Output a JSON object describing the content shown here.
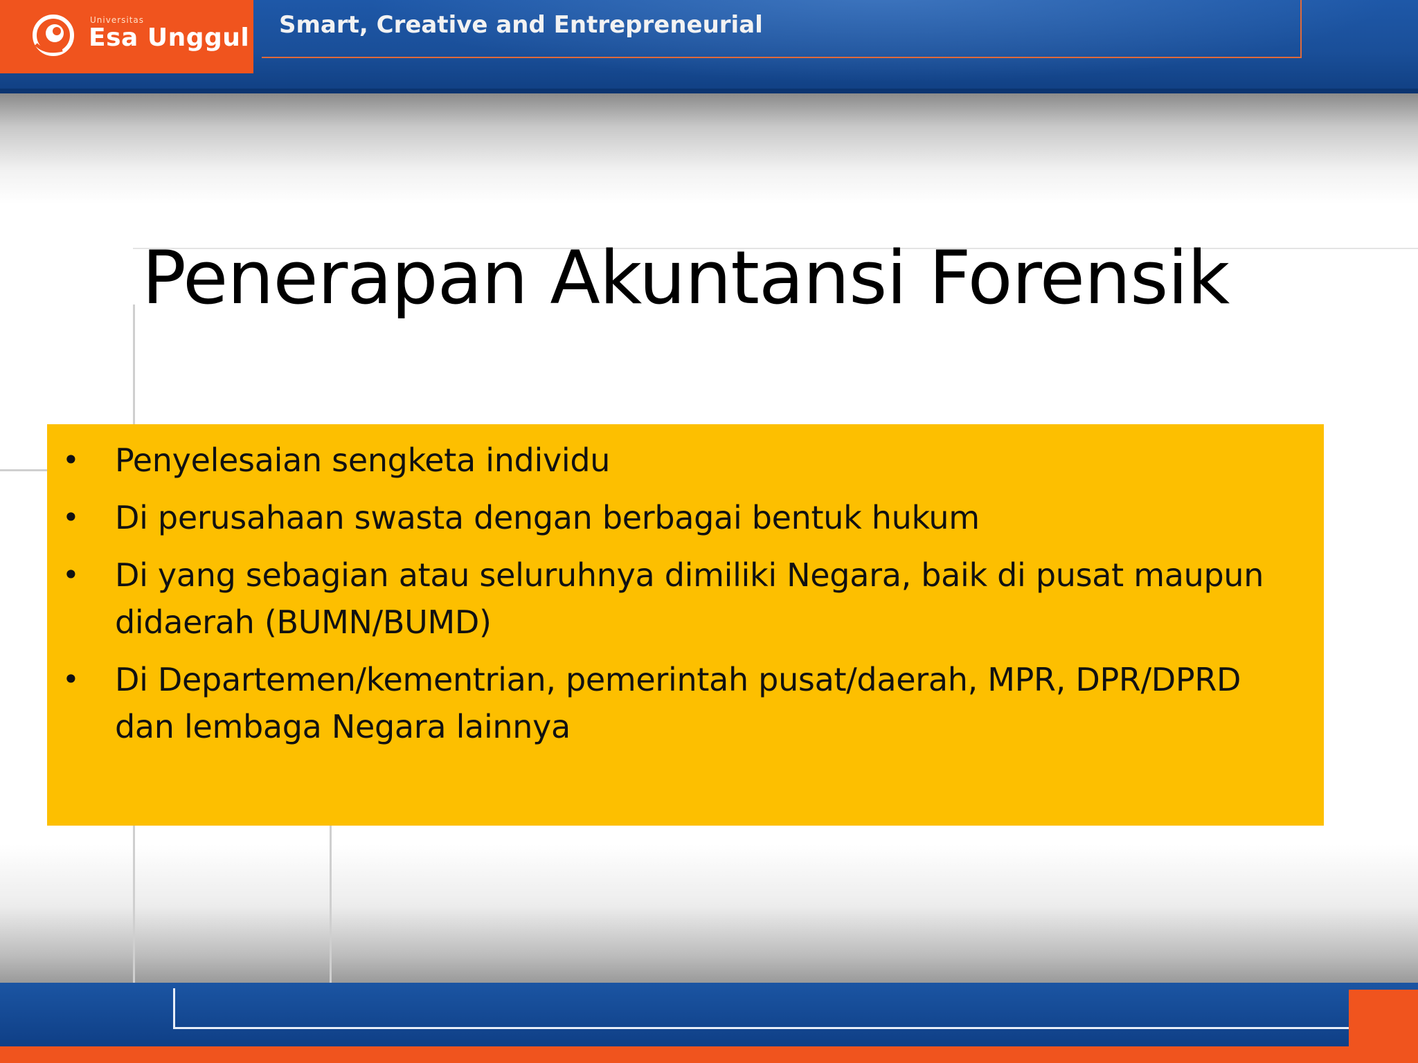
{
  "header": {
    "logo": {
      "small_text": "Universitas",
      "name": "Esa Unggul",
      "icon": "esa-unggul-logo-icon"
    },
    "tagline": "Smart, Creative and Entrepreneurial"
  },
  "slide": {
    "title": "Penerapan Akuntansi Forensik",
    "bullets": [
      "Penyelesaian sengketa individu",
      "Di perusahaan swasta dengan berbagai bentuk hukum",
      "Di yang sebagian atau seluruhnya dimiliki Negara, baik di pusat maupun didaerah (BUMN/BUMD)",
      "Di Departemen/kementrian, pemerintah pusat/daerah, MPR, DPR/DPRD dan lembaga Negara lainnya"
    ],
    "bullet_symbol": "•"
  },
  "colors": {
    "brand_orange": "#f0541e",
    "brand_blue": "#1a4f99",
    "content_box": "#fdbf00"
  }
}
